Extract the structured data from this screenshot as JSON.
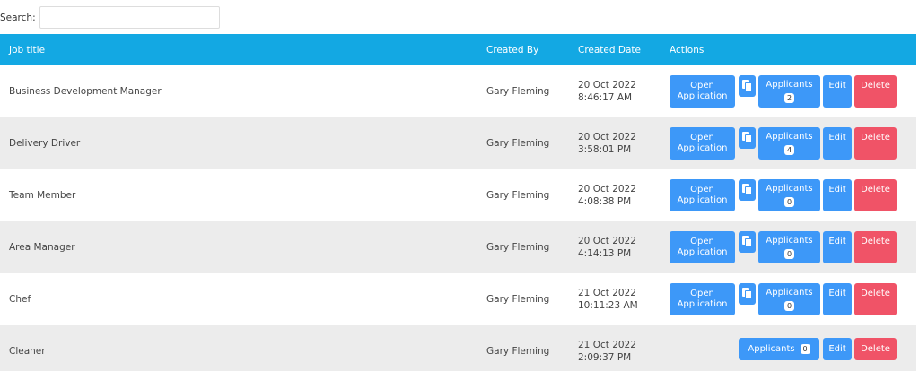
{
  "search": {
    "label": "Search:",
    "value": "",
    "placeholder": ""
  },
  "table": {
    "headers": {
      "title": "Job title",
      "created_by": "Created By",
      "created_date": "Created Date",
      "actions": "Actions"
    },
    "rows": [
      {
        "title": "Business Development Manager",
        "created_by": "Gary Fleming",
        "date": "20 Oct 2022",
        "time": "8:46:17 AM",
        "applicants": "2"
      },
      {
        "title": "Delivery Driver",
        "created_by": "Gary Fleming",
        "date": "20 Oct 2022",
        "time": "3:58:01 PM",
        "applicants": "4"
      },
      {
        "title": "Team Member",
        "created_by": "Gary Fleming",
        "date": "20 Oct 2022",
        "time": "4:08:38 PM",
        "applicants": "0"
      },
      {
        "title": "Area Manager",
        "created_by": "Gary Fleming",
        "date": "20 Oct 2022",
        "time": "4:14:13 PM",
        "applicants": "0"
      },
      {
        "title": "Chef",
        "created_by": "Gary Fleming",
        "date": "21 Oct 2022",
        "time": "10:11:23 AM",
        "applicants": "0"
      },
      {
        "title": "Cleaner",
        "created_by": "Gary Fleming",
        "date": "21 Oct 2022",
        "time": "2:09:37 PM",
        "applicants": "0"
      }
    ]
  },
  "actions": {
    "open_line1": "Open",
    "open_line2": "Application",
    "applicants_label": "Applicants",
    "edit_label": "Edit",
    "delete_label": "Delete",
    "copy_icon": "copy-icon"
  },
  "colors": {
    "header_bg": "#13a8e3",
    "button_blue": "#3d98f8",
    "button_red": "#f05367",
    "row_alt": "#ececec"
  }
}
